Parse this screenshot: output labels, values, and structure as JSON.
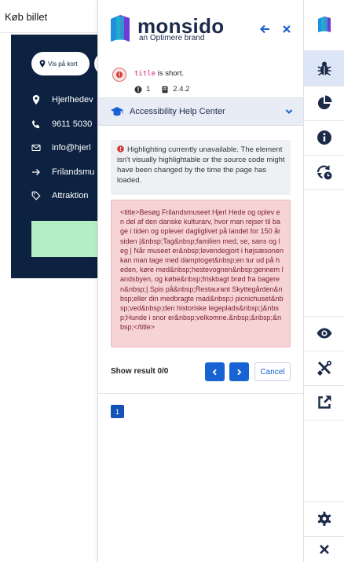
{
  "website": {
    "top_link": "Køb billet",
    "map_button": "Vis på kort",
    "contacts": [
      {
        "icon": "location-pin-icon",
        "text": "Hjerlhedev"
      },
      {
        "icon": "phone-icon",
        "text": "9611 5030"
      },
      {
        "icon": "envelope-icon",
        "text": "info@hjerl"
      },
      {
        "icon": "arrow-right-icon",
        "text": "Frilandsmu"
      },
      {
        "icon": "tag-icon",
        "text": "Attraktion"
      }
    ]
  },
  "panel": {
    "brand_name": "monsido",
    "brand_tagline": "an Optimere brand",
    "check": {
      "code": "title",
      "message": " is short.",
      "count": "1",
      "wcag": "2.4.2"
    },
    "help_center": "Accessibility Help Center",
    "warning": "Highlighting currently unavailable. The element isn't visually highlightable or the source code might have been changed by the time the page has loaded.",
    "snippet": "<title>Besøg Frilandsmuseet Hjerl Hede og oplev en del af den danske kulturarv, hvor man rejser til bage i tiden og oplever dagliglivet på landet for 150 år siden |&nbsp;Tag&nbsp;familien med, se, sans og leg | Når museet er&nbsp;levendegjort i højsæsonen kan man tage med damptoget&nbsp;en tur ud på heden, køre med&nbsp;hestevognen&nbsp;gennem landsbyen, og købe&nbsp;friskbagt brød fra bageren&nbsp;| Spis på&nbsp;Restaurant Skyttegården&nbsp;eller din medbragte mad&nbsp;i picnichuset&nbsp;ved&nbsp;den historiske legeplads&nbsp;|&nbsp;Hunde i snor er&nbsp;velkomne.&nbsp;&nbsp;&nbsp;</title>",
    "show_result": "Show result 0/0",
    "cancel": "Cancel",
    "page_number": "1"
  },
  "colors": {
    "navy": "#0d2240",
    "accent_blue": "#1763d3",
    "error_red": "#d33a3a",
    "snippet_bg": "#f6d4d6",
    "help_bar_bg": "#e8ecf5"
  }
}
